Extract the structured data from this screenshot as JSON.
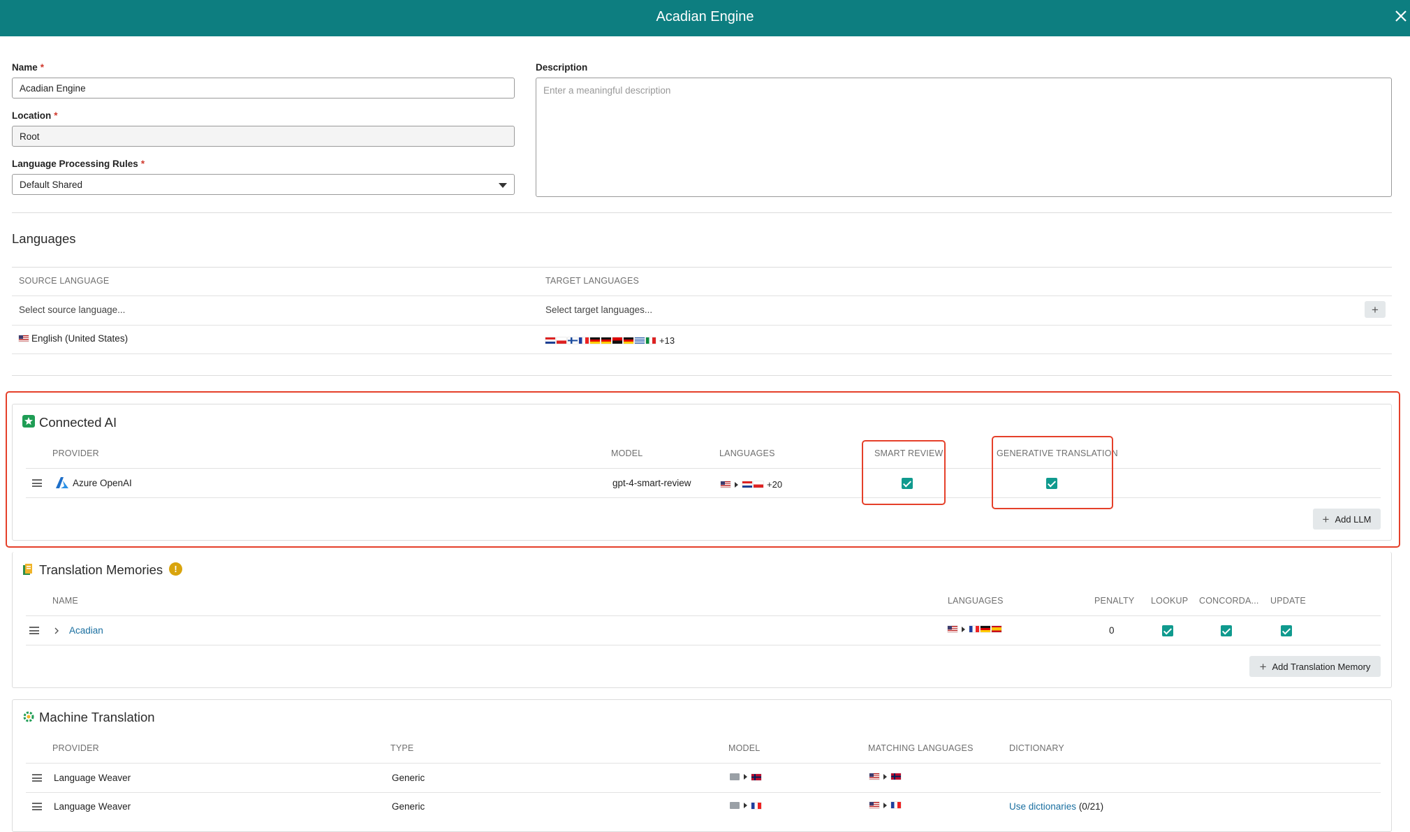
{
  "window": {
    "title": "Acadian Engine",
    "close_icon": "close-icon"
  },
  "form": {
    "name": {
      "label": "Name",
      "required": "*",
      "value": "Acadian Engine"
    },
    "location": {
      "label": "Location",
      "required": "*",
      "value": "Root"
    },
    "rules": {
      "label": "Language Processing Rules",
      "required": "*",
      "value": "Default Shared"
    },
    "description": {
      "label": "Description",
      "placeholder": "Enter a meaningful description"
    }
  },
  "languages": {
    "title": "Languages",
    "headers": {
      "source": "SOURCE LANGUAGE",
      "target": "TARGET LANGUAGES"
    },
    "source_placeholder": "Select source language...",
    "target_placeholder": "Select target languages...",
    "add_label": "+",
    "row": {
      "source": "English (United States)",
      "target_more": "+13"
    }
  },
  "connected_ai": {
    "title": "Connected AI",
    "headers": {
      "provider": "PROVIDER",
      "model": "MODEL",
      "languages": "LANGUAGES",
      "smart_review": "SMART REVIEW",
      "generative": "GENERATIVE TRANSLATION"
    },
    "row": {
      "provider": "Azure OpenAI",
      "model": "gpt-4-smart-review",
      "languages_more": "+20",
      "smart_review": true,
      "generative": true
    },
    "add_button": "Add LLM"
  },
  "translation_memories": {
    "title": "Translation Memories",
    "warn_label": "!",
    "headers": {
      "name": "NAME",
      "languages": "LANGUAGES",
      "penalty": "PENALTY",
      "lookup": "LOOKUP",
      "concordance": "CONCORDA...",
      "update": "UPDATE"
    },
    "row": {
      "name": "Acadian",
      "penalty": "0",
      "lookup": true,
      "concordance": true,
      "update": true
    },
    "add_button": "Add Translation Memory"
  },
  "machine_translation": {
    "title": "Machine Translation",
    "headers": {
      "provider": "PROVIDER",
      "type": "TYPE",
      "model": "MODEL",
      "matching": "MATCHING LANGUAGES",
      "dictionary": "DICTIONARY"
    },
    "rows": [
      {
        "provider": "Language Weaver",
        "type": "Generic",
        "dictionary_link": "",
        "dictionary_count": ""
      },
      {
        "provider": "Language Weaver",
        "type": "Generic",
        "dictionary_link": "Use dictionaries",
        "dictionary_count": "(0/21)"
      }
    ]
  },
  "colors": {
    "header": "#0d7e80",
    "checkbox": "#109a8e",
    "highlight": "#e5402a",
    "link": "#1a6fa0"
  }
}
